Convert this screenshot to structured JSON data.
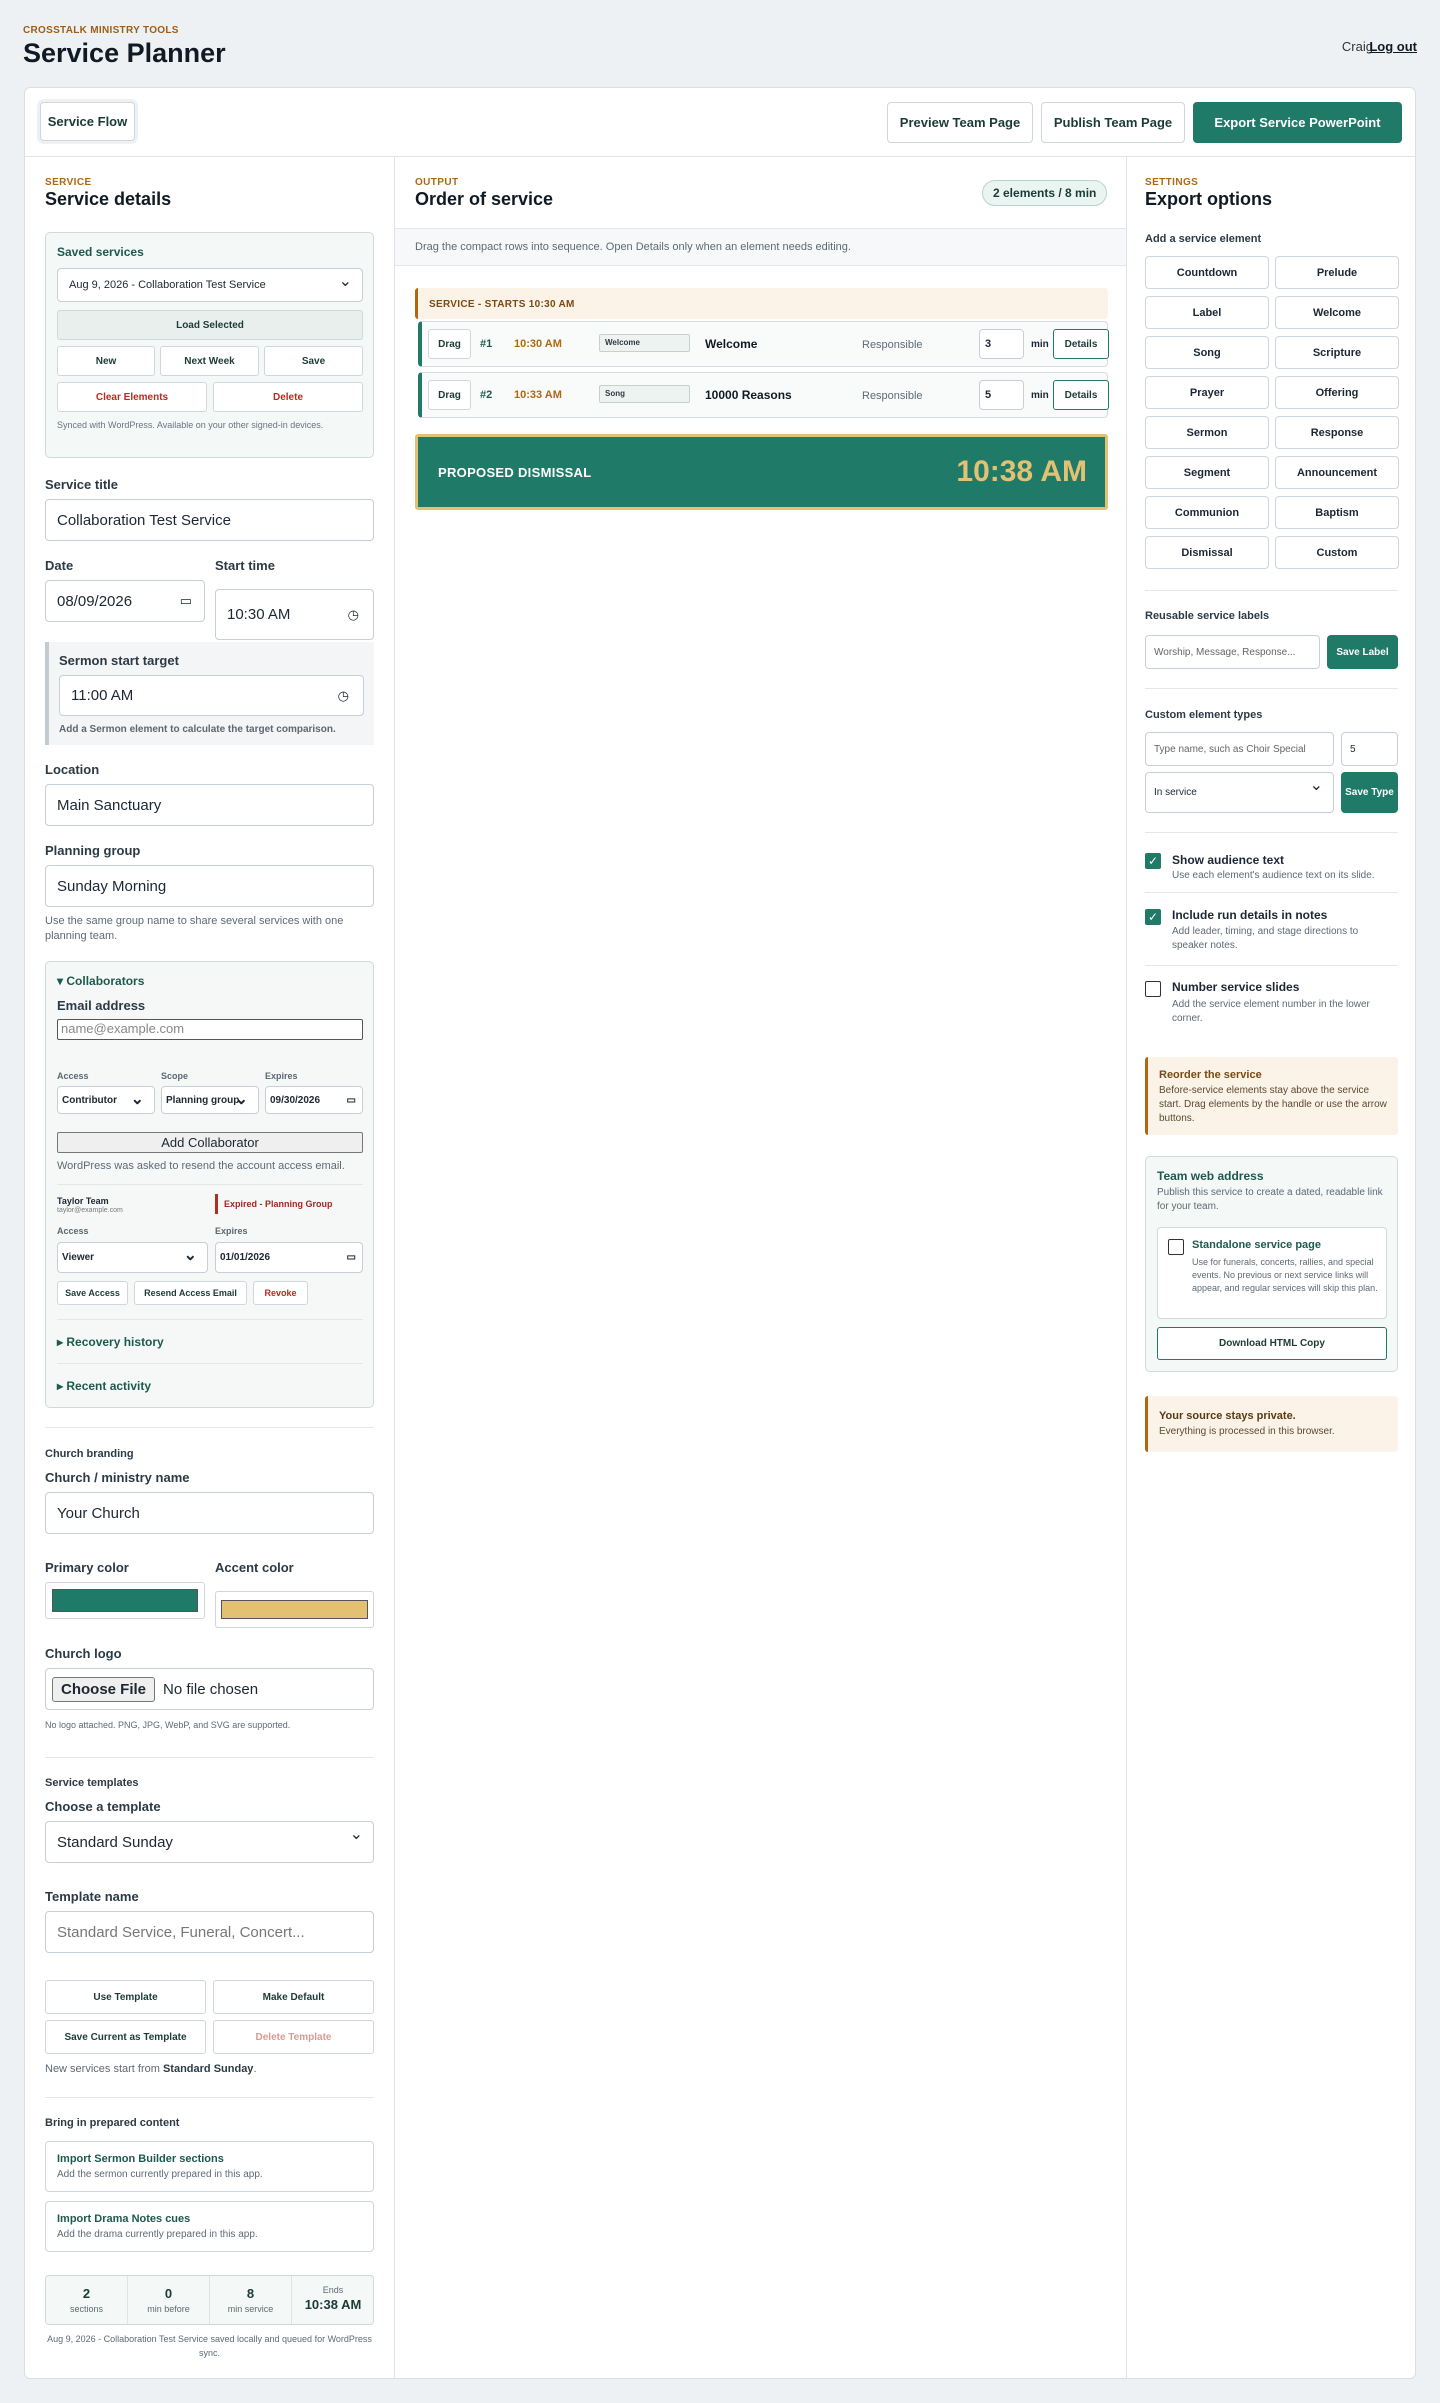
{
  "app": {
    "brand": "CROSSTALK MINISTRY TOOLS",
    "title": "Service Planner",
    "user": "Craig",
    "logout": "Log out"
  },
  "toolbar": {
    "tab": "Service Flow",
    "preview": "Preview Team Page",
    "publish": "Publish Team Page",
    "export": "Export Service PowerPoint"
  },
  "left": {
    "section": "SERVICE",
    "heading": "Service details",
    "saved": {
      "title": "Saved services",
      "selected": "Aug 9, 2026 - Collaboration Test Service",
      "load": "Load Selected",
      "new": "New",
      "next": "Next Week",
      "save": "Save",
      "clear": "Clear Elements",
      "delete": "Delete",
      "note": "Synced with WordPress. Available on your other signed-in devices."
    },
    "service_title_label": "Service title",
    "service_title": "Collaboration Test Service",
    "date_label": "Date",
    "date": "08/09/2026",
    "start_label": "Start time",
    "start": "10:30 AM",
    "sermon_label": "Sermon start target",
    "sermon": "11:00 AM",
    "sermon_note": "Add a Sermon element to calculate the target comparison.",
    "location_label": "Location",
    "location": "Main Sanctuary",
    "group_label": "Planning group",
    "group": "Sunday Morning",
    "group_note": "Use the same group name to share several services with one planning team.",
    "collab": {
      "title": "▾ Collaborators",
      "email_label": "Email address",
      "email_ph": "name@example.com",
      "access_label": "Access",
      "scope_label": "Scope",
      "expires_label": "Expires",
      "access": "Contributor",
      "scope": "Planning group",
      "expires": "09/30/2026",
      "add": "Add Collaborator",
      "resend_note": "WordPress was asked to resend the account access email.",
      "member_name": "Taylor Team",
      "member_email": "taylor@example.com",
      "member_status": "Expired - Planning Group",
      "m_access_label": "Access",
      "m_expires_label": "Expires",
      "m_access": "Viewer",
      "m_expires": "01/01/2026",
      "save_access": "Save Access",
      "resend": "Resend Access Email",
      "revoke": "Revoke",
      "recovery": "▸ Recovery history",
      "activity": "▸ Recent activity"
    },
    "branding": {
      "title": "Church branding",
      "name_label": "Church / ministry name",
      "name": "Your Church",
      "primary_label": "Primary color",
      "accent_label": "Accent color",
      "primary": "#1f7a67",
      "accent": "#e3c173",
      "logo_label": "Church logo",
      "choose": "Choose File",
      "nofile": "No file chosen",
      "logo_note": "No logo attached. PNG, JPG, WebP, and SVG are supported."
    },
    "templates": {
      "title": "Service templates",
      "choose_label": "Choose a template",
      "choose": "Standard Sunday",
      "name_label": "Template name",
      "name_ph": "Standard Service, Funeral, Concert...",
      "use": "Use Template",
      "default": "Make Default",
      "save": "Save Current as Template",
      "delete": "Delete Template",
      "note_pre": "New services start from ",
      "note_bold": "Standard Sunday",
      "note_post": "."
    },
    "prepared": {
      "title": "Bring in prepared content",
      "sermon_t": "Import Sermon Builder sections",
      "sermon_d": "Add the sermon currently prepared in this app.",
      "drama_t": "Import Drama Notes cues",
      "drama_d": "Add the drama currently prepared in this app."
    },
    "stats": [
      {
        "v": "2",
        "l": "sections"
      },
      {
        "v": "0",
        "l": "min before"
      },
      {
        "v": "8",
        "l": "min service"
      }
    ],
    "ends_label": "Ends",
    "ends": "10:38 AM",
    "footer": "Aug 9, 2026 - Collaboration Test Service saved locally and queued for WordPress sync."
  },
  "middle": {
    "section": "OUTPUT",
    "heading": "Order of service",
    "badge": "2 elements / 8 min",
    "hint": "Drag the compact rows into sequence. Open Details only when an element needs editing.",
    "starts": "SERVICE - STARTS 10:30 AM",
    "rows": [
      {
        "drag": "Drag",
        "num": "#1",
        "time": "10:30 AM",
        "type": "Welcome",
        "name": "Welcome",
        "resp": "Responsible",
        "min": "3",
        "unit": "min",
        "details": "Details"
      },
      {
        "drag": "Drag",
        "num": "#2",
        "time": "10:33 AM",
        "type": "Song",
        "name": "10000 Reasons",
        "resp": "Responsible",
        "min": "5",
        "unit": "min",
        "details": "Details"
      }
    ],
    "dismissal_label": "PROPOSED DISMISSAL",
    "dismissal_time": "10:38 AM"
  },
  "right": {
    "section": "SETTINGS",
    "heading": "Export options",
    "add_label": "Add a service element",
    "elements": [
      "Countdown",
      "Prelude",
      "Label",
      "Welcome",
      "Song",
      "Scripture",
      "Prayer",
      "Offering",
      "Sermon",
      "Response",
      "Segment",
      "Announcement",
      "Communion",
      "Baptism",
      "Dismissal",
      "Custom"
    ],
    "labels_title": "Reusable service labels",
    "labels_ph": "Worship, Message, Response...",
    "save_label": "Save Label",
    "custom_title": "Custom element types",
    "custom_ph": "Type name, such as Choir Special",
    "custom_min": "5",
    "custom_when": "In service",
    "save_type": "Save Type",
    "opts": [
      {
        "t": "Show audience text",
        "d": "Use each element's audience text on its slide.",
        "on": true
      },
      {
        "t": "Include run details in notes",
        "d": "Add leader, timing, and stage directions to speaker notes.",
        "on": true
      },
      {
        "t": "Number service slides",
        "d": "Add the service element number in the lower corner.",
        "on": false
      }
    ],
    "reorder_t": "Reorder the service",
    "reorder_d": "Before-service elements stay above the service start. Drag elements by the handle or use the arrow buttons.",
    "web_t": "Team web address",
    "web_d": "Publish this service to create a dated, readable link for your team.",
    "stand_t": "Standalone service page",
    "stand_d": "Use for funerals, concerts, rallies, and special events. No previous or next service links will appear, and regular services will skip this plan.",
    "download": "Download HTML Copy",
    "private_t": "Your source stays private.",
    "private_d": "Everything is processed in this browser."
  }
}
